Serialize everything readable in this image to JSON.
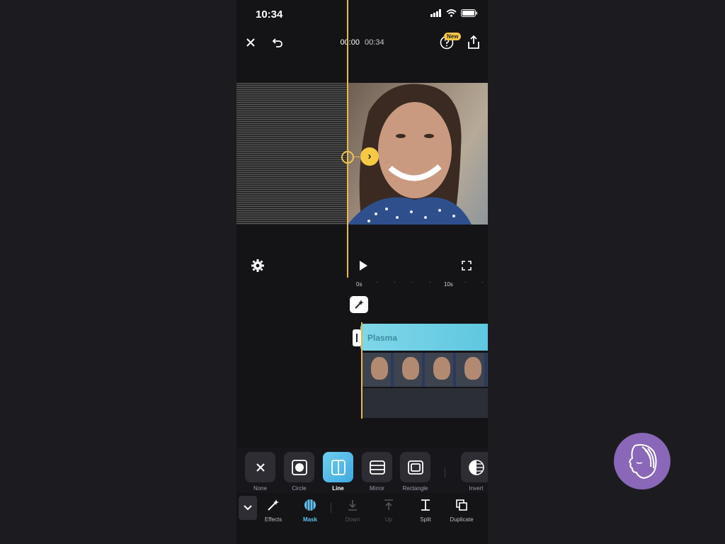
{
  "status_bar": {
    "time": "10:34"
  },
  "top_bar": {
    "current_time": "00:00",
    "total_time": "00:34",
    "new_badge": "New"
  },
  "ruler": {
    "ticks": [
      "0s",
      "10s"
    ]
  },
  "timeline": {
    "effect_clip_label": "Plasma"
  },
  "mask_options": [
    {
      "label": "None",
      "icon": "x-icon",
      "selected": false
    },
    {
      "label": "Circle",
      "icon": "circle-mask-icon",
      "selected": false
    },
    {
      "label": "Line",
      "icon": "line-mask-icon",
      "selected": true
    },
    {
      "label": "Mirror",
      "icon": "mirror-mask-icon",
      "selected": false
    },
    {
      "label": "Rectangle",
      "icon": "rectangle-mask-icon",
      "selected": false
    },
    {
      "label": "Invert",
      "icon": "invert-icon",
      "selected": false
    }
  ],
  "bottom_toolbar": [
    {
      "label": "Effects",
      "icon": "magic-wand-icon",
      "state": "normal"
    },
    {
      "label": "Mask",
      "icon": "mask-icon",
      "state": "active"
    },
    {
      "label": "Down",
      "icon": "move-down-icon",
      "state": "disabled"
    },
    {
      "label": "Up",
      "icon": "move-up-icon",
      "state": "disabled"
    },
    {
      "label": "Split",
      "icon": "split-icon",
      "state": "normal"
    },
    {
      "label": "Duplicate",
      "icon": "duplicate-icon",
      "state": "normal"
    }
  ],
  "colors": {
    "accent": "#f6c945",
    "active": "#5fc3f0",
    "clip": "#6fd0e8"
  }
}
